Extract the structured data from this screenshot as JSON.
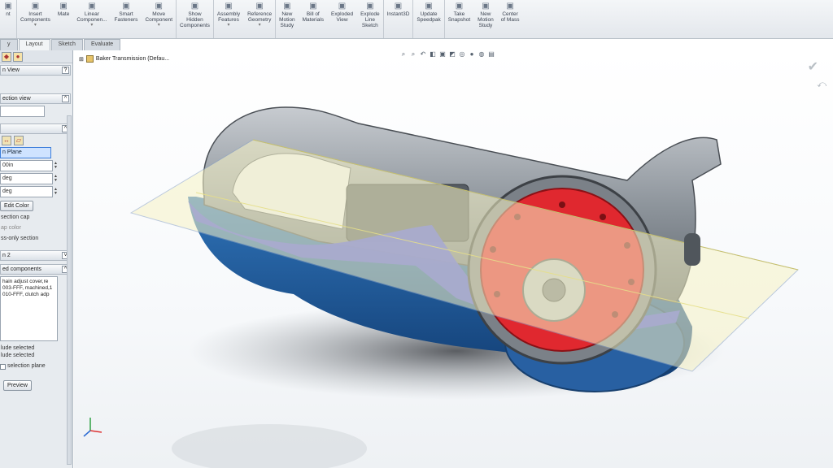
{
  "ribbon": {
    "items": [
      {
        "label": "nt",
        "icon": "assembly-icon",
        "dropdown": false
      },
      {
        "label": "Insert\nComponents",
        "icon": "insert-components-icon",
        "dropdown": true
      },
      {
        "label": "Mate",
        "icon": "mate-icon",
        "dropdown": false
      },
      {
        "label": "Linear\nComponen...",
        "icon": "linear-pattern-icon",
        "dropdown": true
      },
      {
        "label": "Smart\nFasteners",
        "icon": "smart-fasteners-icon",
        "dropdown": false
      },
      {
        "label": "Move\nComponent",
        "icon": "move-component-icon",
        "dropdown": true
      },
      {
        "label": "Show\nHidden\nComponents",
        "icon": "show-hidden-icon",
        "dropdown": false
      },
      {
        "label": "Assembly\nFeatures",
        "icon": "assembly-features-icon",
        "dropdown": true
      },
      {
        "label": "Reference\nGeometry",
        "icon": "reference-geometry-icon",
        "dropdown": true
      },
      {
        "label": "New\nMotion\nStudy",
        "icon": "motion-study-icon",
        "dropdown": false
      },
      {
        "label": "Bill of\nMaterials",
        "icon": "bom-icon",
        "dropdown": false
      },
      {
        "label": "Exploded\nView",
        "icon": "exploded-view-icon",
        "dropdown": false
      },
      {
        "label": "Explode\nLine\nSketch",
        "icon": "explode-line-icon",
        "dropdown": false
      },
      {
        "label": "Instant3D",
        "icon": "instant3d-icon",
        "dropdown": false
      },
      {
        "label": "Update\nSpeedpak",
        "icon": "speedpak-icon",
        "dropdown": false
      },
      {
        "label": "Take\nSnapshot",
        "icon": "snapshot-icon",
        "dropdown": false
      },
      {
        "label": "New\nMotion\nStudy",
        "icon": "motion-study-icon",
        "dropdown": false
      },
      {
        "label": "Center\nof Mass",
        "icon": "center-of-mass-icon",
        "dropdown": false
      }
    ]
  },
  "tabs": [
    "y",
    "Layout",
    "Sketch",
    "Evaluate"
  ],
  "panel": {
    "title": "n View",
    "section_view_header": "ection view",
    "plane_label": "n Plane",
    "offset_value": "00in",
    "angle1": "deg",
    "angle2": "deg",
    "edit_color_button": "Edit Color",
    "section_cap": "section cap",
    "cap_color": "ap color",
    "cross_only": "ss-only section",
    "section2_header": "n 2",
    "sectioned_components_header": "ed components",
    "components": [
      "hain adjust cover,re",
      "003-FFF, machined,1",
      "010-FFF, clutch adp"
    ],
    "exclude_selected": "lude selected",
    "include_selected": "lude selected",
    "selection_plane": "selection plane",
    "preview_button": "Preview"
  },
  "viewport": {
    "document_title": "Baker Transmission  (Defau..."
  },
  "colors": {
    "ribbon_bg": "#e3e7ec",
    "selection_blue": "#cfe3ff",
    "housing_grey": "#8e959c",
    "clutch_red": "#e0282f",
    "cut_face_blue": "#4a53d8",
    "section_plane_yellow": "#f7f3c6"
  }
}
